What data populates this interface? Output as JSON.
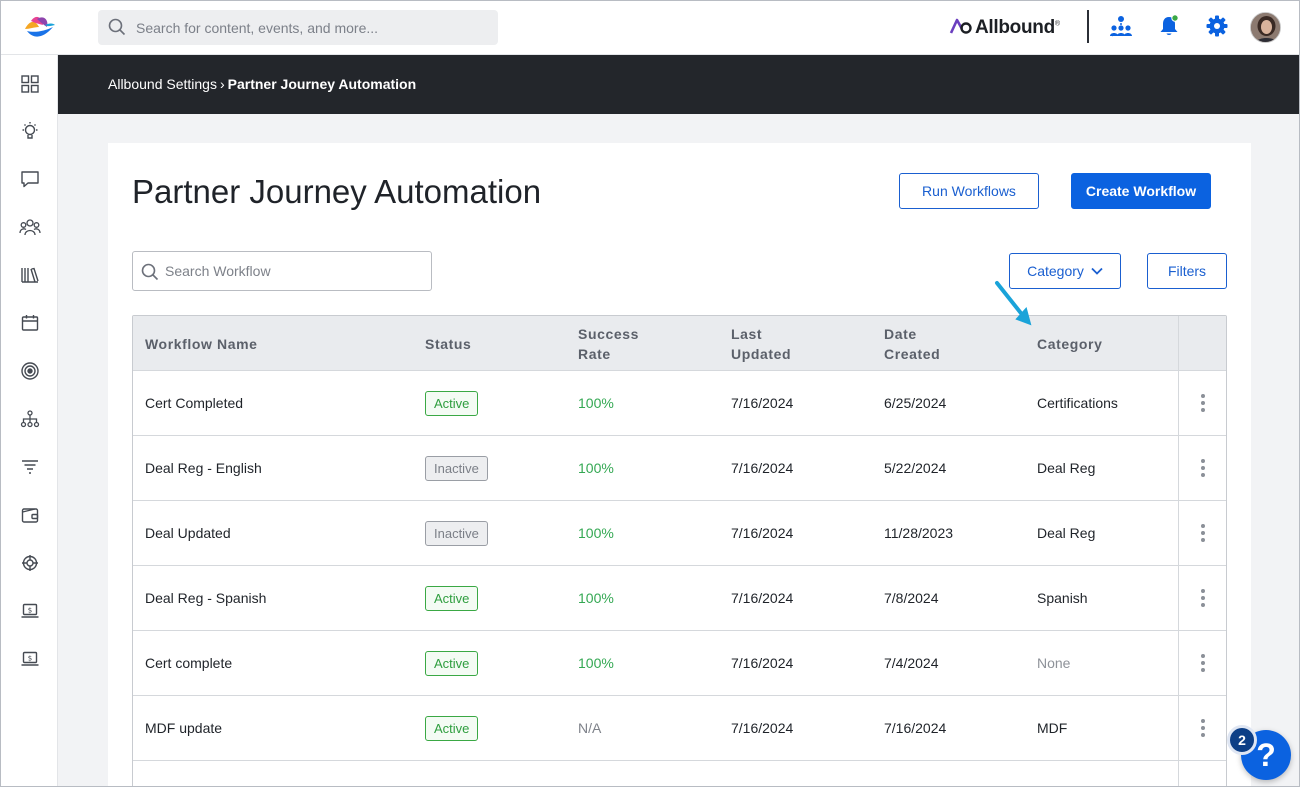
{
  "header": {
    "search_placeholder": "Search for content, events, and more...",
    "brand_name": "Allbound",
    "brand_mark": "®"
  },
  "breadcrumb": {
    "parent": "Allbound Settings",
    "separator": "›",
    "current": "Partner Journey Automation"
  },
  "page": {
    "title": "Partner Journey Automation",
    "run_button": "Run Workflows",
    "create_button": "Create Workflow",
    "search_placeholder": "Search Workflow",
    "category_button": "Category",
    "filters_button": "Filters"
  },
  "table": {
    "columns": {
      "name": "Workflow Name",
      "status": "Status",
      "success_line1": "Success",
      "success_line2": "Rate",
      "updated_line1": "Last",
      "updated_line2": "Updated",
      "created_line1": "Date",
      "created_line2": "Created",
      "category": "Category"
    },
    "rows": [
      {
        "name": "Cert Completed",
        "status": "Active",
        "rate": "100%",
        "updated": "7/16/2024",
        "created": "6/25/2024",
        "category": "Certifications"
      },
      {
        "name": "Deal Reg - English",
        "status": "Inactive",
        "rate": "100%",
        "updated": "7/16/2024",
        "created": "5/22/2024",
        "category": "Deal Reg"
      },
      {
        "name": "Deal Updated",
        "status": "Inactive",
        "rate": "100%",
        "updated": "7/16/2024",
        "created": "11/28/2023",
        "category": "Deal Reg"
      },
      {
        "name": "Deal Reg - Spanish",
        "status": "Active",
        "rate": "100%",
        "updated": "7/16/2024",
        "created": "7/8/2024",
        "category": "Spanish"
      },
      {
        "name": "Cert complete",
        "status": "Active",
        "rate": "100%",
        "updated": "7/16/2024",
        "created": "7/4/2024",
        "category": "None"
      },
      {
        "name": "MDF update",
        "status": "Active",
        "rate": "N/A",
        "updated": "7/16/2024",
        "created": "7/16/2024",
        "category": "MDF"
      }
    ]
  },
  "help": {
    "label": "?",
    "count": "2"
  },
  "colors": {
    "primary": "#0b62e0",
    "active_green": "#3aa844",
    "header_dark": "#23262b",
    "annotation_arrow": "#1aa3d9"
  }
}
